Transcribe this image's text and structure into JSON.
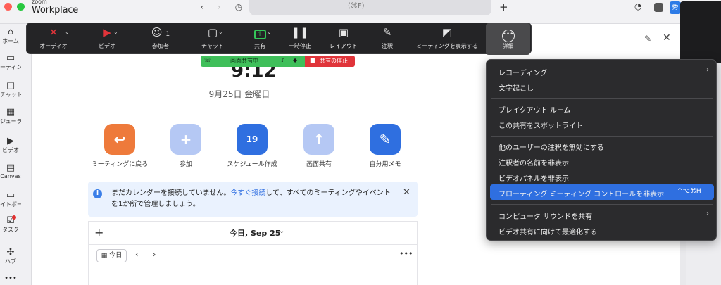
{
  "app": {
    "brand_small": "zoom",
    "brand": "Workplace",
    "search_text": "(⌘F)",
    "avatar_initial": "秀"
  },
  "sidebar": {
    "items": [
      {
        "name": "home",
        "icon": "⌂",
        "label": "ホーム"
      },
      {
        "name": "meeting",
        "icon": "▭",
        "label": "ーティング"
      },
      {
        "name": "chat",
        "icon": "▢",
        "label": "チャット"
      },
      {
        "name": "scheduler",
        "icon": "▦",
        "label": "ジューラー"
      },
      {
        "name": "video",
        "icon": "▶",
        "label": "ビデオ"
      },
      {
        "name": "canvas",
        "icon": "▤",
        "label": "Canvas"
      },
      {
        "name": "whiteboard",
        "icon": "▭",
        "label": "イトボード"
      },
      {
        "name": "tasks",
        "icon": "☑",
        "label": "タスク"
      },
      {
        "name": "hub",
        "icon": "✣",
        "label": "ハブ"
      }
    ],
    "more": "•••"
  },
  "home": {
    "clock": "9:12",
    "date": "9月25日 金曜日",
    "quick_actions": [
      {
        "label": "ミーティングに戻る",
        "icon": "↩",
        "color": "#ee7a3b"
      },
      {
        "label": "参加",
        "icon": "+",
        "color": "#b5c8f4"
      },
      {
        "label": "スケジュール作成",
        "icon": "19",
        "color": "#2f6fe0"
      },
      {
        "label": "画面共有",
        "icon": "↑",
        "color": "#b5c8f4"
      },
      {
        "label": "自分用メモ",
        "icon": "✎",
        "color": "#2f6fe0"
      }
    ],
    "notice": {
      "text_before": "まだカレンダーを接続していません。",
      "link": "今すぐ接続",
      "text_after": "して、すべてのミーティングやイベントを1か所で管理しましょう。"
    },
    "calendar": {
      "title": "今日, Sep 25",
      "today_button": "今日"
    }
  },
  "toolbar": {
    "audio": "オーディオ",
    "video": "ビデオ",
    "participants": "参加者",
    "participants_count": "1",
    "chat": "チャット",
    "share": "共有",
    "pause": "一時停止",
    "layout": "レイアウト",
    "annotate": "注釈",
    "show_meeting": "ミーティングを表示する",
    "more": "詳細"
  },
  "share_banner": {
    "sharing": "画面共有中",
    "stop": "共有の停止"
  },
  "menu": {
    "items": [
      {
        "label": "レコーディング",
        "submenu": true
      },
      {
        "label": "文字起こし"
      },
      {
        "label": "ブレイクアウト ルーム"
      },
      {
        "label": "この共有をスポットライト"
      },
      {
        "label": "他のユーザーの注釈を無効にする"
      },
      {
        "label": "注釈者の名前を非表示"
      },
      {
        "label": "ビデオパネルを非表示"
      },
      {
        "label": "フローティング ミーティング コントロールを非表示",
        "shortcut": "^⌥⌘H",
        "highlighted": true
      },
      {
        "label": "コンピュータ サウンドを共有",
        "submenu": true
      },
      {
        "label": "ビデオ共有に向けて最適化する"
      }
    ]
  },
  "colors": {
    "accent": "#2f6fe0",
    "toolbar_bg": "#242426",
    "share_green": "#3fbf5a",
    "stop_red": "#e0343a"
  }
}
